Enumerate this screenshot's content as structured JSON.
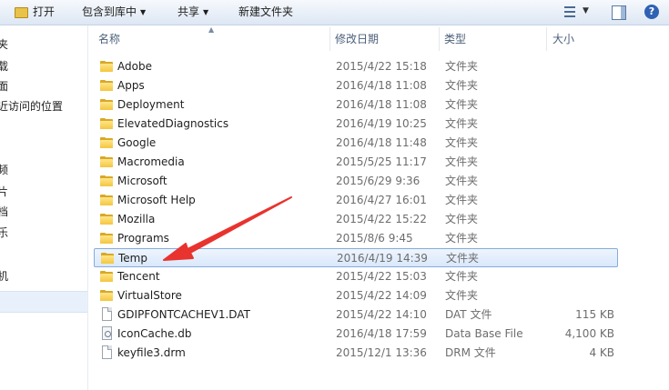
{
  "toolbar": {
    "open_label": "打开",
    "include_label": "包含到库中",
    "share_label": "共享",
    "new_folder_label": "新建文件夹",
    "help_label": "?"
  },
  "nav": {
    "items": [
      "夹",
      "载",
      "面",
      "近访问的位置",
      "频",
      "片",
      "档",
      "乐",
      "机"
    ]
  },
  "columns": {
    "name": "名称",
    "date": "修改日期",
    "type": "类型",
    "size": "大小"
  },
  "files": [
    {
      "name": "Adobe",
      "date": "2015/4/22 15:18",
      "type": "文件夹",
      "size": "",
      "icon": "folder-icon"
    },
    {
      "name": "Apps",
      "date": "2016/4/18 11:08",
      "type": "文件夹",
      "size": "",
      "icon": "folder-icon"
    },
    {
      "name": "Deployment",
      "date": "2016/4/18 11:08",
      "type": "文件夹",
      "size": "",
      "icon": "folder-icon"
    },
    {
      "name": "ElevatedDiagnostics",
      "date": "2016/4/19 10:25",
      "type": "文件夹",
      "size": "",
      "icon": "folder-icon"
    },
    {
      "name": "Google",
      "date": "2016/4/18 11:48",
      "type": "文件夹",
      "size": "",
      "icon": "folder-icon"
    },
    {
      "name": "Macromedia",
      "date": "2015/5/25 11:17",
      "type": "文件夹",
      "size": "",
      "icon": "folder-icon"
    },
    {
      "name": "Microsoft",
      "date": "2015/6/29 9:36",
      "type": "文件夹",
      "size": "",
      "icon": "folder-icon"
    },
    {
      "name": "Microsoft Help",
      "date": "2016/4/27 16:01",
      "type": "文件夹",
      "size": "",
      "icon": "folder-icon"
    },
    {
      "name": "Mozilla",
      "date": "2015/4/22 15:22",
      "type": "文件夹",
      "size": "",
      "icon": "folder-icon"
    },
    {
      "name": "Programs",
      "date": "2015/8/6 9:45",
      "type": "文件夹",
      "size": "",
      "icon": "folder-icon"
    },
    {
      "name": "Temp",
      "date": "2016/4/19 14:39",
      "type": "文件夹",
      "size": "",
      "icon": "folder-icon"
    },
    {
      "name": "Tencent",
      "date": "2015/4/22 15:03",
      "type": "文件夹",
      "size": "",
      "icon": "folder-icon"
    },
    {
      "name": "VirtualStore",
      "date": "2015/4/22 14:09",
      "type": "文件夹",
      "size": "",
      "icon": "folder-icon"
    },
    {
      "name": "GDIPFONTCACHEV1.DAT",
      "date": "2015/4/22 14:10",
      "type": "DAT 文件",
      "size": "115 KB",
      "icon": "file-icon"
    },
    {
      "name": "IconCache.db",
      "date": "2016/4/18 17:59",
      "type": "Data Base File",
      "size": "4,100 KB",
      "icon": "database-file-icon"
    },
    {
      "name": "keyfile3.drm",
      "date": "2015/12/1 13:36",
      "type": "DRM 文件",
      "size": "4 KB",
      "icon": "file-icon"
    }
  ],
  "selected_file": "Temp",
  "annotation": {
    "color": "#e8332f"
  }
}
